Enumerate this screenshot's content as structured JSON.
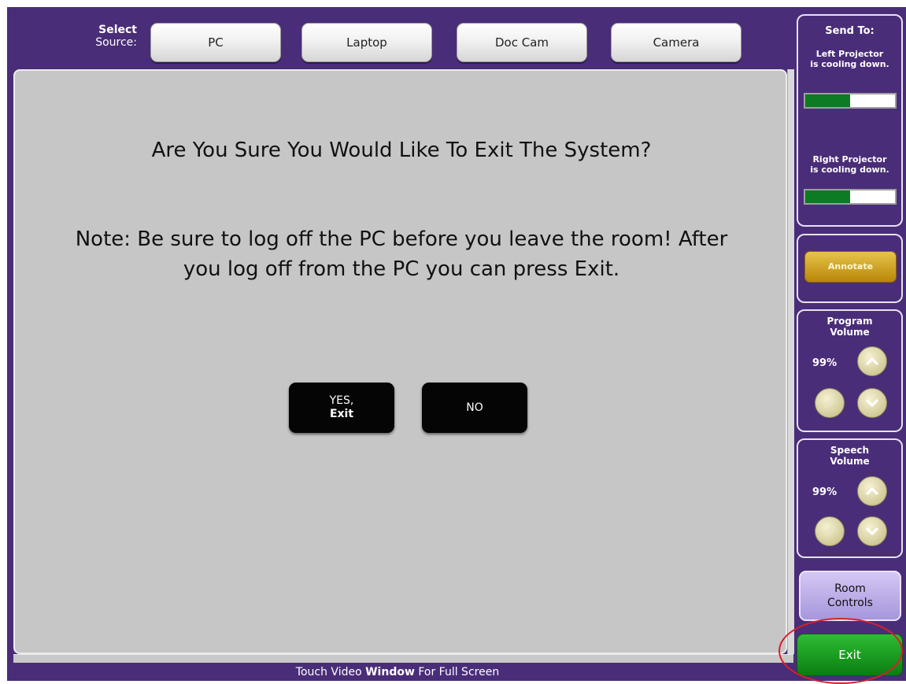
{
  "source_bar": {
    "label_line1": "Select",
    "label_line2": "Source:",
    "buttons": [
      "PC",
      "Laptop",
      "Doc Cam",
      "Camera"
    ]
  },
  "dialog": {
    "question": "Are You Sure You Would Like To Exit The System?",
    "note": "Note: Be sure to log off the PC before you leave the room! After you log off from the PC you can press Exit.",
    "yes_line1": "YES,",
    "yes_line2": "Exit",
    "no_label": "NO"
  },
  "footer": {
    "text_part1": "Touch Video ",
    "text_bold": "Window",
    "text_part2": " For Full Screen"
  },
  "send_to": {
    "title": "Send To:",
    "left_status_1": "Left Projector",
    "left_status_2": "is cooling down.",
    "left_progress": 0.5,
    "right_status_1": "Right Projector",
    "right_status_2": "is cooling down.",
    "right_progress": 0.5
  },
  "annotate": {
    "label": "Annotate"
  },
  "program_volume": {
    "title_1": "Program",
    "title_2": "Volume",
    "value": "99%"
  },
  "speech_volume": {
    "title_1": "Speech",
    "title_2": "Volume",
    "value": "99%"
  },
  "room_controls": {
    "line1": "Room",
    "line2": "Controls"
  },
  "exit": {
    "label": "Exit"
  },
  "colors": {
    "frame": "#4a2d78",
    "main": "#c6c6c6",
    "exit_green": "#1a9b21",
    "annotate_gold": "#c8970f",
    "highlight_ring": "#d8202c"
  }
}
